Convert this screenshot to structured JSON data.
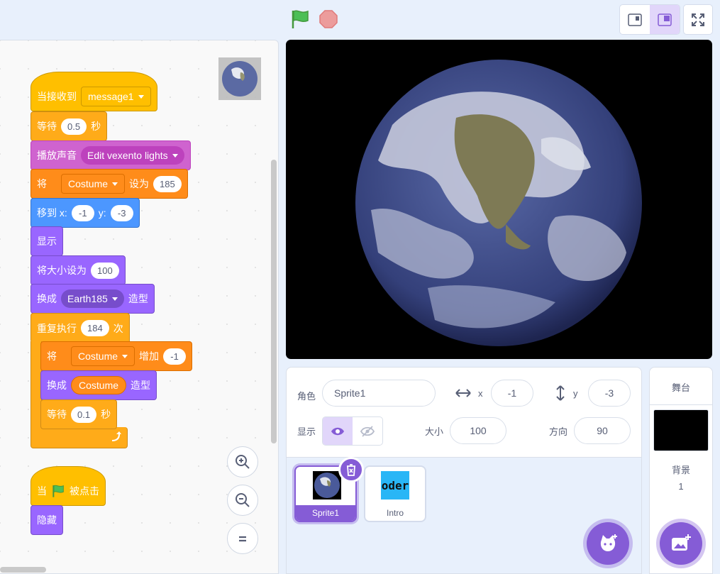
{
  "code": {
    "script1": {
      "hat_label": "当接收到",
      "hat_message": "message1",
      "wait_label": "等待",
      "wait_value": "0.5",
      "wait_unit": "秒",
      "play_sound_label": "播放声音",
      "sound_name": "Edit vexento lights",
      "set_var_label": "将",
      "set_var_name": "Costume",
      "set_var_to": "设为",
      "set_var_value": "185",
      "goto_label": "移到 x:",
      "goto_x": "-1",
      "goto_y_label": "y:",
      "goto_y": "-3",
      "show_label": "显示",
      "set_size_label": "将大小设为",
      "set_size_value": "100",
      "switch_label": "换成",
      "switch_costume": "Earth185",
      "switch_suffix": "造型",
      "repeat_label": "重复执行",
      "repeat_value": "184",
      "repeat_unit": "次",
      "change_label": "将",
      "change_var": "Costume",
      "change_by": "增加",
      "change_value": "-1",
      "inner_switch_label": "换成",
      "inner_switch_reporter": "Costume",
      "inner_switch_suffix": "造型",
      "inner_wait_label": "等待",
      "inner_wait_value": "0.1",
      "inner_wait_unit": "秒"
    },
    "script2": {
      "hat_prefix": "当",
      "hat_suffix": "被点击",
      "hide_label": "隐藏"
    }
  },
  "sprite_info": {
    "sprite_label": "角色",
    "sprite_name": "Sprite1",
    "x_label": "x",
    "x_value": "-1",
    "y_label": "y",
    "y_value": "-3",
    "show_label": "显示",
    "size_label": "大小",
    "size_value": "100",
    "direction_label": "方向",
    "direction_value": "90"
  },
  "sprites": [
    {
      "name": "Sprite1"
    },
    {
      "name": "Intro",
      "thumb_text": "oder"
    }
  ],
  "stage_panel": {
    "title": "舞台",
    "backdrop_label": "背景",
    "backdrop_count": "1"
  },
  "colors": {
    "accent": "#855cd6",
    "events": "#ffbf00",
    "motion": "#4c97ff",
    "looks": "#9966ff",
    "sound": "#cf63cf",
    "variables": "#ff8c1a",
    "control": "#ffab19"
  }
}
